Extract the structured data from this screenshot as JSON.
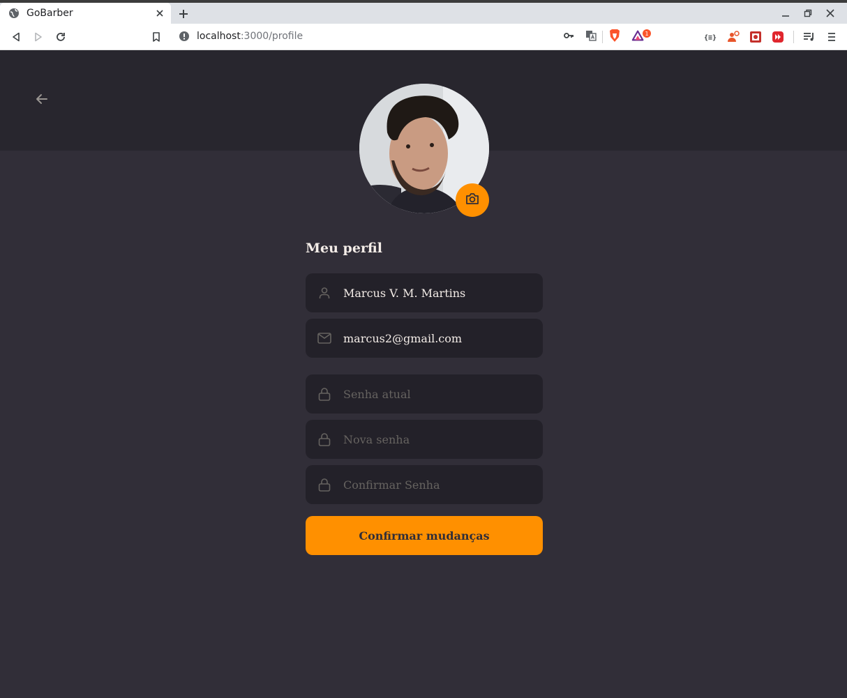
{
  "browser": {
    "tab_title": "GoBarber",
    "url_host": "localhost",
    "url_path": ":3000/profile",
    "notification_count": "1"
  },
  "page": {
    "title": "Meu perfil",
    "fields": {
      "name": {
        "value": "Marcus V. M. Martins",
        "icon": "user-icon"
      },
      "email": {
        "value": "marcus2@gmail.com",
        "icon": "mail-icon"
      },
      "old_password": {
        "placeholder": "Senha atual",
        "icon": "lock-icon"
      },
      "new_password": {
        "placeholder": "Nova senha",
        "icon": "lock-icon"
      },
      "confirm_password": {
        "placeholder": "Confirmar Senha",
        "icon": "lock-icon"
      }
    },
    "submit_label": "Confirmar mudanças"
  },
  "colors": {
    "background": "#312e38",
    "header": "#28262e",
    "input_bg": "#232129",
    "accent": "#ff9000",
    "text": "#f4ede8",
    "placeholder": "#666360"
  }
}
